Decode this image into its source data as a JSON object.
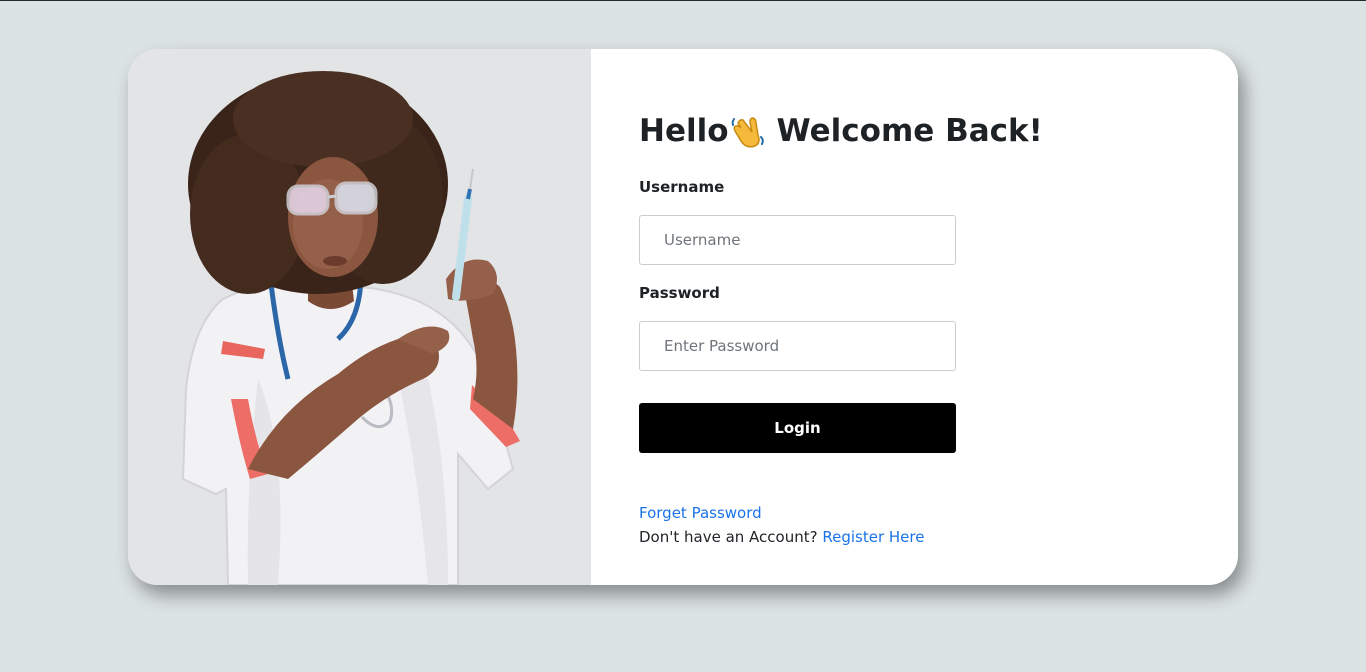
{
  "login": {
    "title_before": "Hello",
    "title_after": "Welcome Back!",
    "title_emoji_icon": "waving-hand-icon",
    "username_label": "Username",
    "username_placeholder": "Username",
    "password_label": "Password",
    "password_placeholder": "Enter Password",
    "login_button": "Login",
    "forget_password": "Forget Password",
    "no_account_text": "Don't have an Account?",
    "register_link": "Register Here"
  },
  "colors": {
    "page_background": "#dce3e3",
    "card_background": "#ffffff",
    "button_background": "#000000",
    "button_text": "#ffffff",
    "link": "#1a73e8",
    "heading_text": "#1f2225"
  }
}
